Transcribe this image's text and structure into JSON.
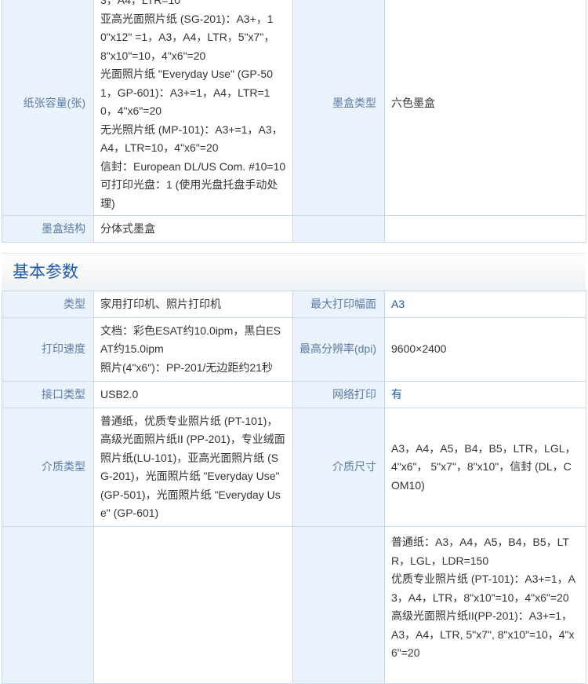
{
  "top_table": {
    "rows": [
      {
        "label": "纸张容量(张)",
        "value_lines": [
          "3，A4，LTR=10",
          "亚高光面照片纸 (SG-201)：A3+，10\"x12\" =1，A3，A4，LTR，5\"x7\"，8\"x10\"=10，4\"x6\"=20",
          "光面照片纸 \"Everyday Use\" (GP-501，GP-601)：A3+=1，A4，LTR=10，4\"x6\"=20",
          "无光照片纸 (MP-101)：A3+=1，A3，A4，LTR=10，4\"x6\"=20",
          "信封：European DL/US Com. #10=10",
          "可打印光盘：1 (使用光盘托盘手动处理)"
        ],
        "label2": "墨盒类型",
        "value2": "六色墨盒"
      },
      {
        "label": "墨盒结构",
        "value": "分体式墨盒",
        "label2": "",
        "value2": ""
      }
    ]
  },
  "section": {
    "title": "基本参数"
  },
  "basic_table": {
    "rows": [
      {
        "label": "类型",
        "value": "家用打印机、照片打印机",
        "label2": "最大打印幅面",
        "value2": "A3"
      },
      {
        "label": "打印速度",
        "value_lines": [
          "文档：彩色ESAT约10.0ipm，黑白ESAT约15.0ipm",
          "照片(4\"x6\")：PP-201/无边距约21秒"
        ],
        "label2": "最高分辨率(dpi)",
        "value2": "9600×2400"
      },
      {
        "label": "接口类型",
        "value": "USB2.0",
        "label2": "网络打印",
        "value2": "有"
      },
      {
        "label": "介质类型",
        "value": "普通纸，优质专业照片纸 (PT-101)，高级光面照片纸II (PP-201)，专业绒面照片纸(LU-101)，亚高光面照片纸 (SG-201)，光面照片纸 \"Everyday Use\" (GP-501)，光面照片纸 \"Everyday Use\" (GP-601)",
        "label2": "介质尺寸",
        "value2": "A3，A4，A5，B4，B5，LTR，LGL，4\"x6\"， 5\"x7\"，8\"x10\"，信封 (DL，COM10)"
      },
      {
        "label": "",
        "value": "",
        "label2": "",
        "value2_lines": [
          "普通纸：A3，A4，A5，B4，B5，LTR，LGL，LDR=150",
          "优质专业照片纸 (PT-101)：A3+=1，A3，A4，LTR，8\"x10\"=10，4\"x6\"=20",
          "高级光面照片纸II(PP-201)：A3+=1，A3，A4，LTR, 5\"x7\", 8\"x10\"=10，4\"x6\"=20"
        ]
      }
    ]
  },
  "colors": {
    "label_bg": "#eaf2fb",
    "label_text": "#5b7ca3",
    "border": "#c9d9ec",
    "link": "#1f5aa6",
    "section_title": "#1f5aa6"
  }
}
